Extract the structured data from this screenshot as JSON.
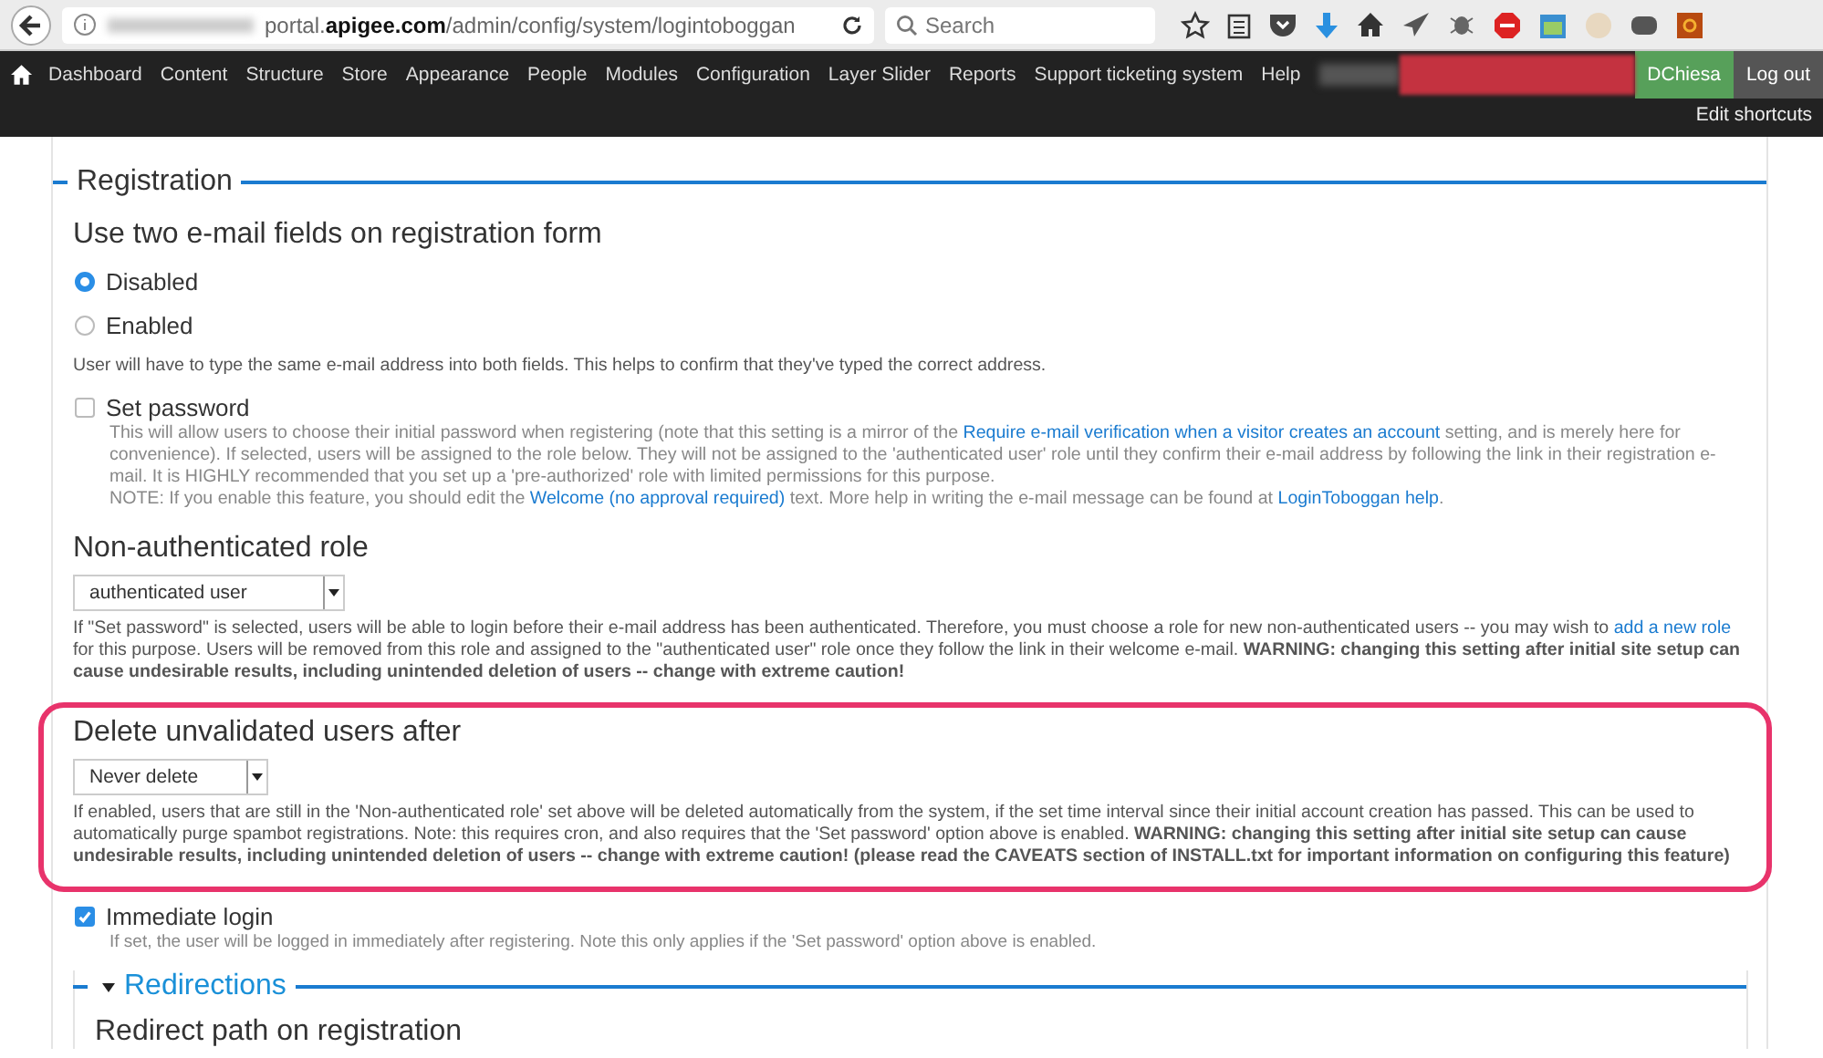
{
  "browser": {
    "url": "portal.**apigee.com**/admin/config/system/logintoboggan",
    "search_placeholder": "Search"
  },
  "nav": {
    "items": [
      "Dashboard",
      "Content",
      "Structure",
      "Store",
      "Appearance",
      "People",
      "Modules",
      "Configuration",
      "Layer Slider",
      "Reports",
      "Support ticketing system",
      "Help"
    ],
    "user": "DChiesa",
    "logout": "Log out",
    "shortcuts": "Edit shortcuts"
  },
  "registration": {
    "legend": "Registration",
    "email_fields": {
      "title": "Use two e-mail fields on registration form",
      "options": [
        {
          "label": "Disabled",
          "selected": true
        },
        {
          "label": "Enabled",
          "selected": false
        }
      ],
      "description": "User will have to type the same e-mail address into both fields. This helps to confirm that they've typed the correct address."
    },
    "set_password": {
      "label": "Set password",
      "checked": false,
      "description": [
        {
          "kind": "text",
          "text": "This will allow users to choose their initial password when registering (note that this setting is a mirror of the "
        },
        {
          "kind": "link",
          "text": "Require e-mail verification when a visitor creates an account"
        },
        {
          "kind": "text",
          "text": " setting, and is merely here for convenience). If selected, users will be assigned to the role below. They will not be assigned to the 'authenticated user' role until they confirm their e-mail address by following the link in their registration e-mail. It is HIGHLY recommended that you set up a 'pre-authorized' role with limited permissions for this purpose."
        },
        {
          "kind": "break"
        },
        {
          "kind": "text",
          "text": "NOTE: If you enable this feature, you should edit the "
        },
        {
          "kind": "link",
          "text": "Welcome (no approval required)"
        },
        {
          "kind": "text",
          "text": " text. More help in writing the e-mail message can be found at "
        },
        {
          "kind": "link",
          "text": "LoginToboggan help"
        },
        {
          "kind": "text",
          "text": "."
        }
      ]
    },
    "role": {
      "title": "Non-authenticated role",
      "value": "authenticated user",
      "highlighted": false,
      "description": [
        {
          "kind": "text",
          "text": "If \"Set password\" is selected, users will be able to login before their e-mail address has been authenticated. Therefore, you must choose a role for new non-authenticated users -- you may wish to "
        },
        {
          "kind": "link",
          "text": "add a new role"
        },
        {
          "kind": "text",
          "text": " for this purpose. Users will be removed from this role and assigned to the \"authenticated user\" role once they follow the link in their welcome e-mail. **WARNING: changing this setting after initial site setup can cause undesirable results, including unintended deletion of users -- change with extreme caution!**"
        }
      ]
    },
    "delete_after": {
      "title": "Delete unvalidated users after",
      "value": "Never delete",
      "highlighted": true,
      "description": [
        {
          "kind": "text",
          "text": "If enabled, users that are still in the 'Non-authenticated role' set above will be deleted automatically from the system, if the set time interval since their initial account creation has passed. This can be used to automatically purge spambot registrations. Note: this requires cron, and also requires that the 'Set password' option above is enabled. **WARNING: changing this setting after initial site setup can cause undesirable results, including unintended deletion of users -- change with extreme caution! (please read the CAVEATS section of INSTALL.txt for important information on configuring this feature)**"
        }
      ]
    },
    "immediate_login": {
      "label": "Immediate login",
      "checked": true,
      "description": "If set, the user will be logged in immediately after registering. Note this only applies if the 'Set password' option above is enabled."
    },
    "redirections": {
      "legend": "Redirections",
      "expanded": true,
      "subtitle": "Redirect path on registration"
    }
  }
}
